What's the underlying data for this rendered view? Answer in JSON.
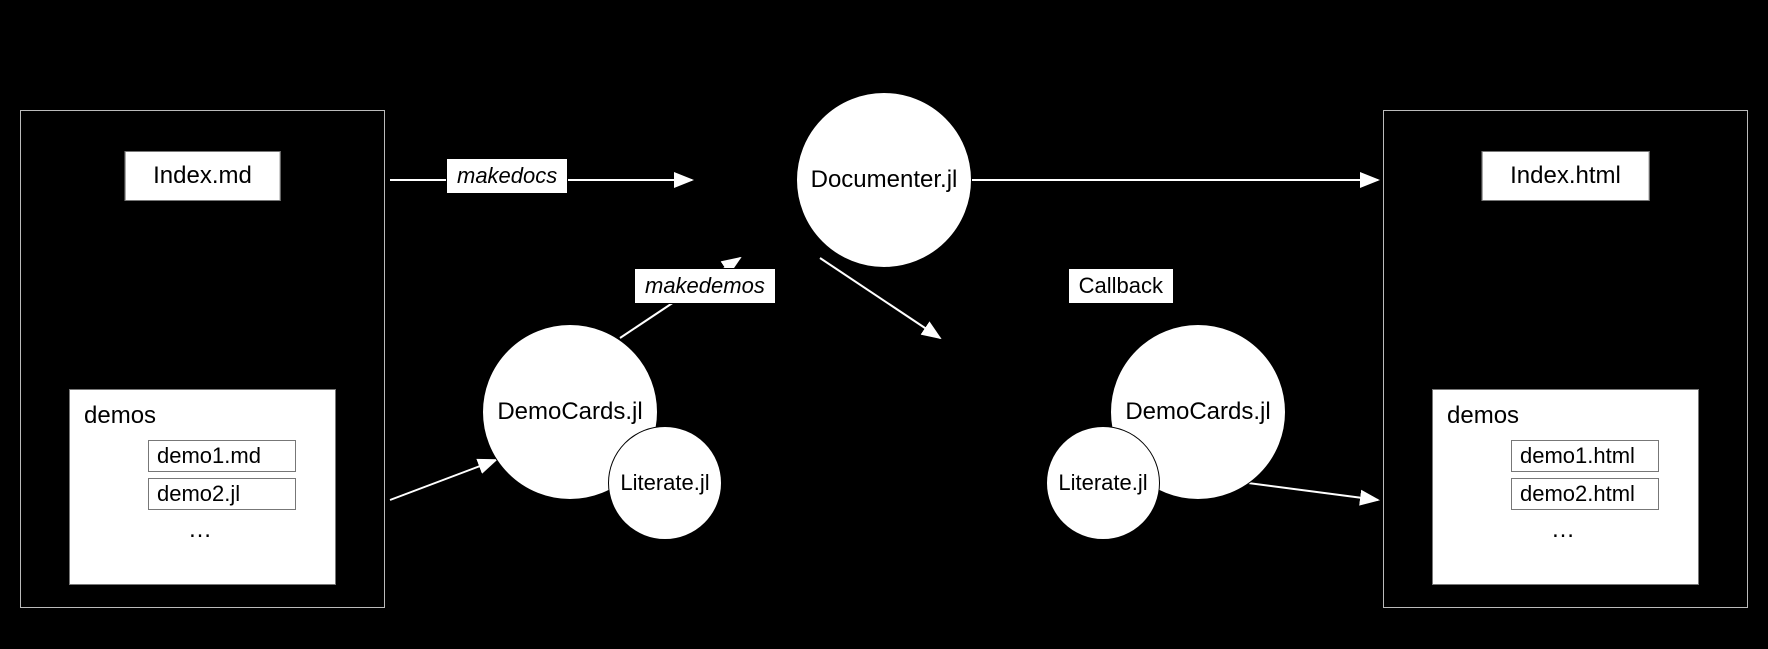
{
  "left_panel": {
    "top_file": "Index.md",
    "demos_label": "demos",
    "items": [
      "demo1.md",
      "demo2.jl"
    ],
    "ellipsis": "…"
  },
  "right_panel": {
    "top_file": "Index.html",
    "demos_label": "demos",
    "items": [
      "demo1.html",
      "demo2.html"
    ],
    "ellipsis": "…"
  },
  "flow": {
    "documenter": "Documenter.jl",
    "democards_left": "DemoCards.jl",
    "democards_right": "DemoCards.jl",
    "literate_left": "Literate.jl",
    "literate_right": "Literate.jl",
    "label_makedocs": "makedocs",
    "label_makedemos": "makedemos",
    "label_callback": "Callback"
  }
}
